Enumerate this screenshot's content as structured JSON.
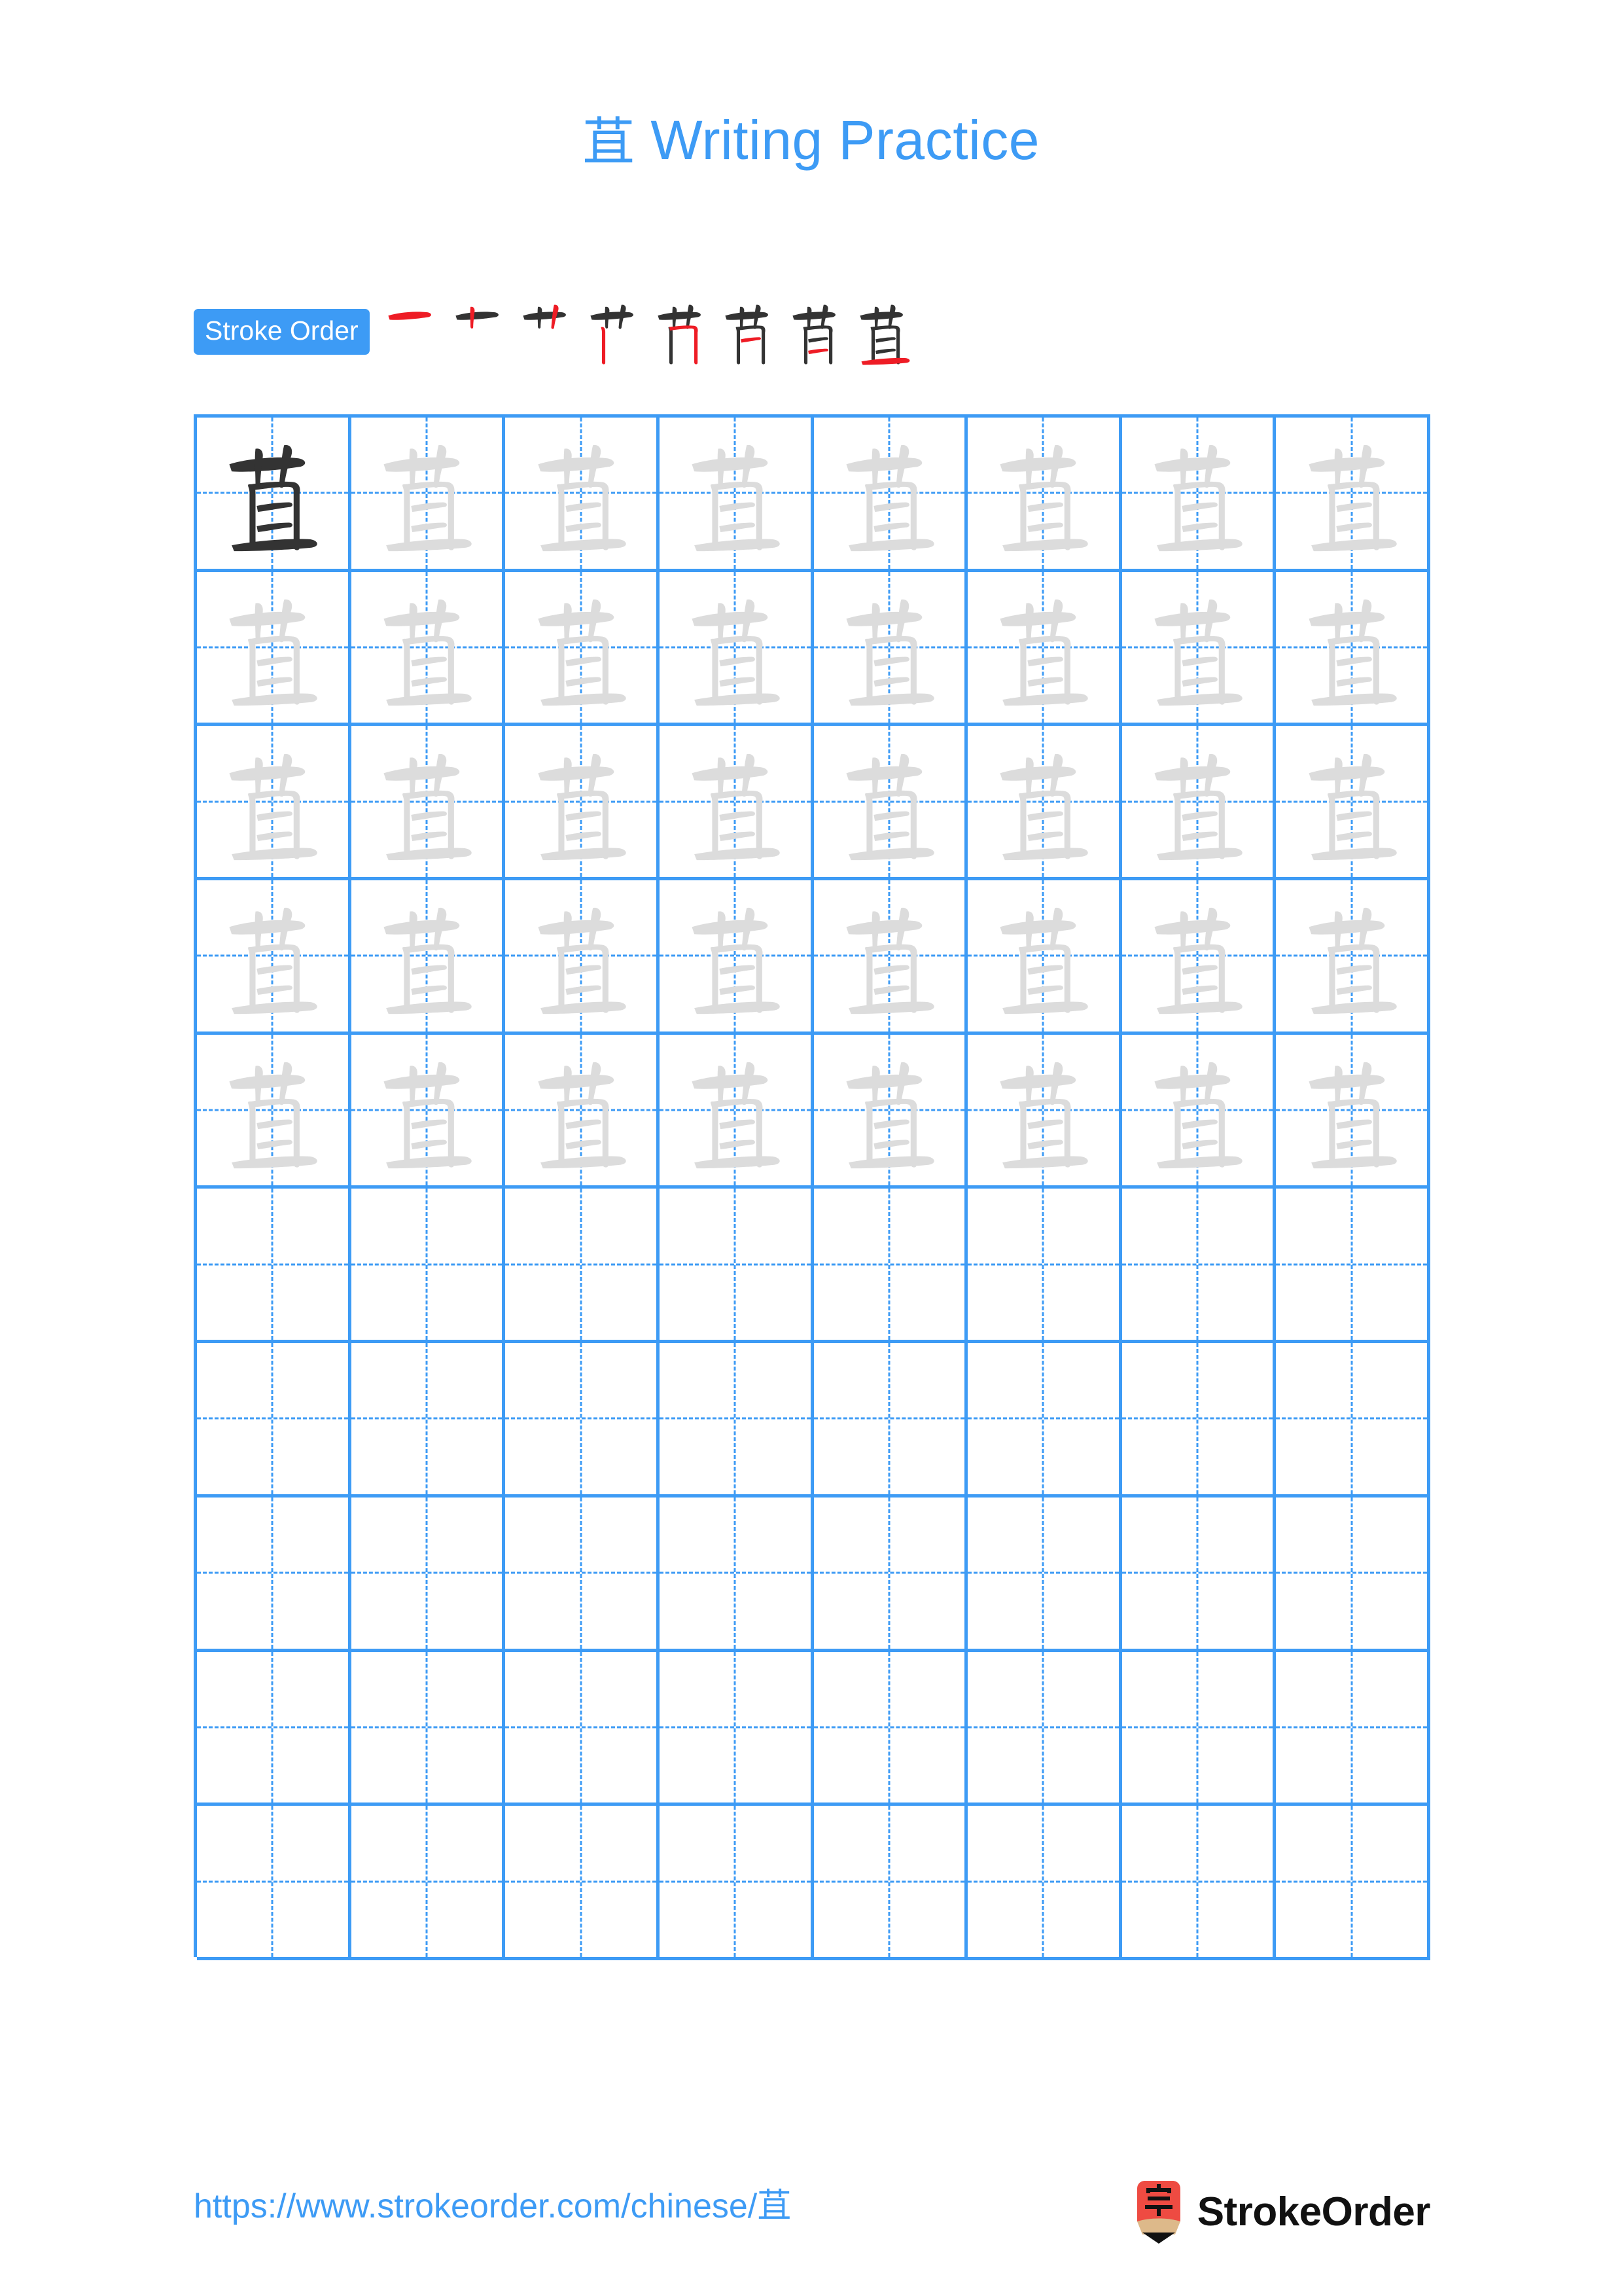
{
  "page": {
    "background_color": "#ffffff",
    "accent_color": "#3d9bf5",
    "character": "苴",
    "trace_color": "#dcdcdc",
    "ink_color": "#333333",
    "stroke_highlight_color": "#ee1c25"
  },
  "header": {
    "character": "苴",
    "title_suffix": " Writing Practice",
    "full_title": "苴 Writing Practice"
  },
  "stroke_order": {
    "badge_label": "Stroke Order",
    "total_strokes": 8,
    "steps": [
      {
        "index": 1,
        "strokes_drawn": 1,
        "new_stroke_name": "heng"
      },
      {
        "index": 2,
        "strokes_drawn": 2,
        "new_stroke_name": "shu"
      },
      {
        "index": 3,
        "strokes_drawn": 3,
        "new_stroke_name": "shu"
      },
      {
        "index": 4,
        "strokes_drawn": 4,
        "new_stroke_name": "shu"
      },
      {
        "index": 5,
        "strokes_drawn": 5,
        "new_stroke_name": "heng-zhe"
      },
      {
        "index": 6,
        "strokes_drawn": 6,
        "new_stroke_name": "heng"
      },
      {
        "index": 7,
        "strokes_drawn": 7,
        "new_stroke_name": "heng"
      },
      {
        "index": 8,
        "strokes_drawn": 8,
        "new_stroke_name": "heng"
      }
    ]
  },
  "practice_grid": {
    "columns": 8,
    "rows": 10,
    "filled_rows": 5,
    "empty_rows": 5,
    "cells": [
      [
        "ink",
        "trace",
        "trace",
        "trace",
        "trace",
        "trace",
        "trace",
        "trace"
      ],
      [
        "trace",
        "trace",
        "trace",
        "trace",
        "trace",
        "trace",
        "trace",
        "trace"
      ],
      [
        "trace",
        "trace",
        "trace",
        "trace",
        "trace",
        "trace",
        "trace",
        "trace"
      ],
      [
        "trace",
        "trace",
        "trace",
        "trace",
        "trace",
        "trace",
        "trace",
        "trace"
      ],
      [
        "trace",
        "trace",
        "trace",
        "trace",
        "trace",
        "trace",
        "trace",
        "trace"
      ],
      [
        "empty",
        "empty",
        "empty",
        "empty",
        "empty",
        "empty",
        "empty",
        "empty"
      ],
      [
        "empty",
        "empty",
        "empty",
        "empty",
        "empty",
        "empty",
        "empty",
        "empty"
      ],
      [
        "empty",
        "empty",
        "empty",
        "empty",
        "empty",
        "empty",
        "empty",
        "empty"
      ],
      [
        "empty",
        "empty",
        "empty",
        "empty",
        "empty",
        "empty",
        "empty",
        "empty"
      ],
      [
        "empty",
        "empty",
        "empty",
        "empty",
        "empty",
        "empty",
        "empty",
        "empty"
      ]
    ]
  },
  "footer": {
    "url_prefix": "https://www.strokeorder.com/chinese/",
    "url_character": "苴",
    "url_full": "https://www.strokeorder.com/chinese/苴",
    "brand_name": "StrokeOrder",
    "logo_character": "字",
    "logo_colors": {
      "body": "#ee4b42",
      "wood": "#ddb98a",
      "tip": "#111111"
    }
  }
}
